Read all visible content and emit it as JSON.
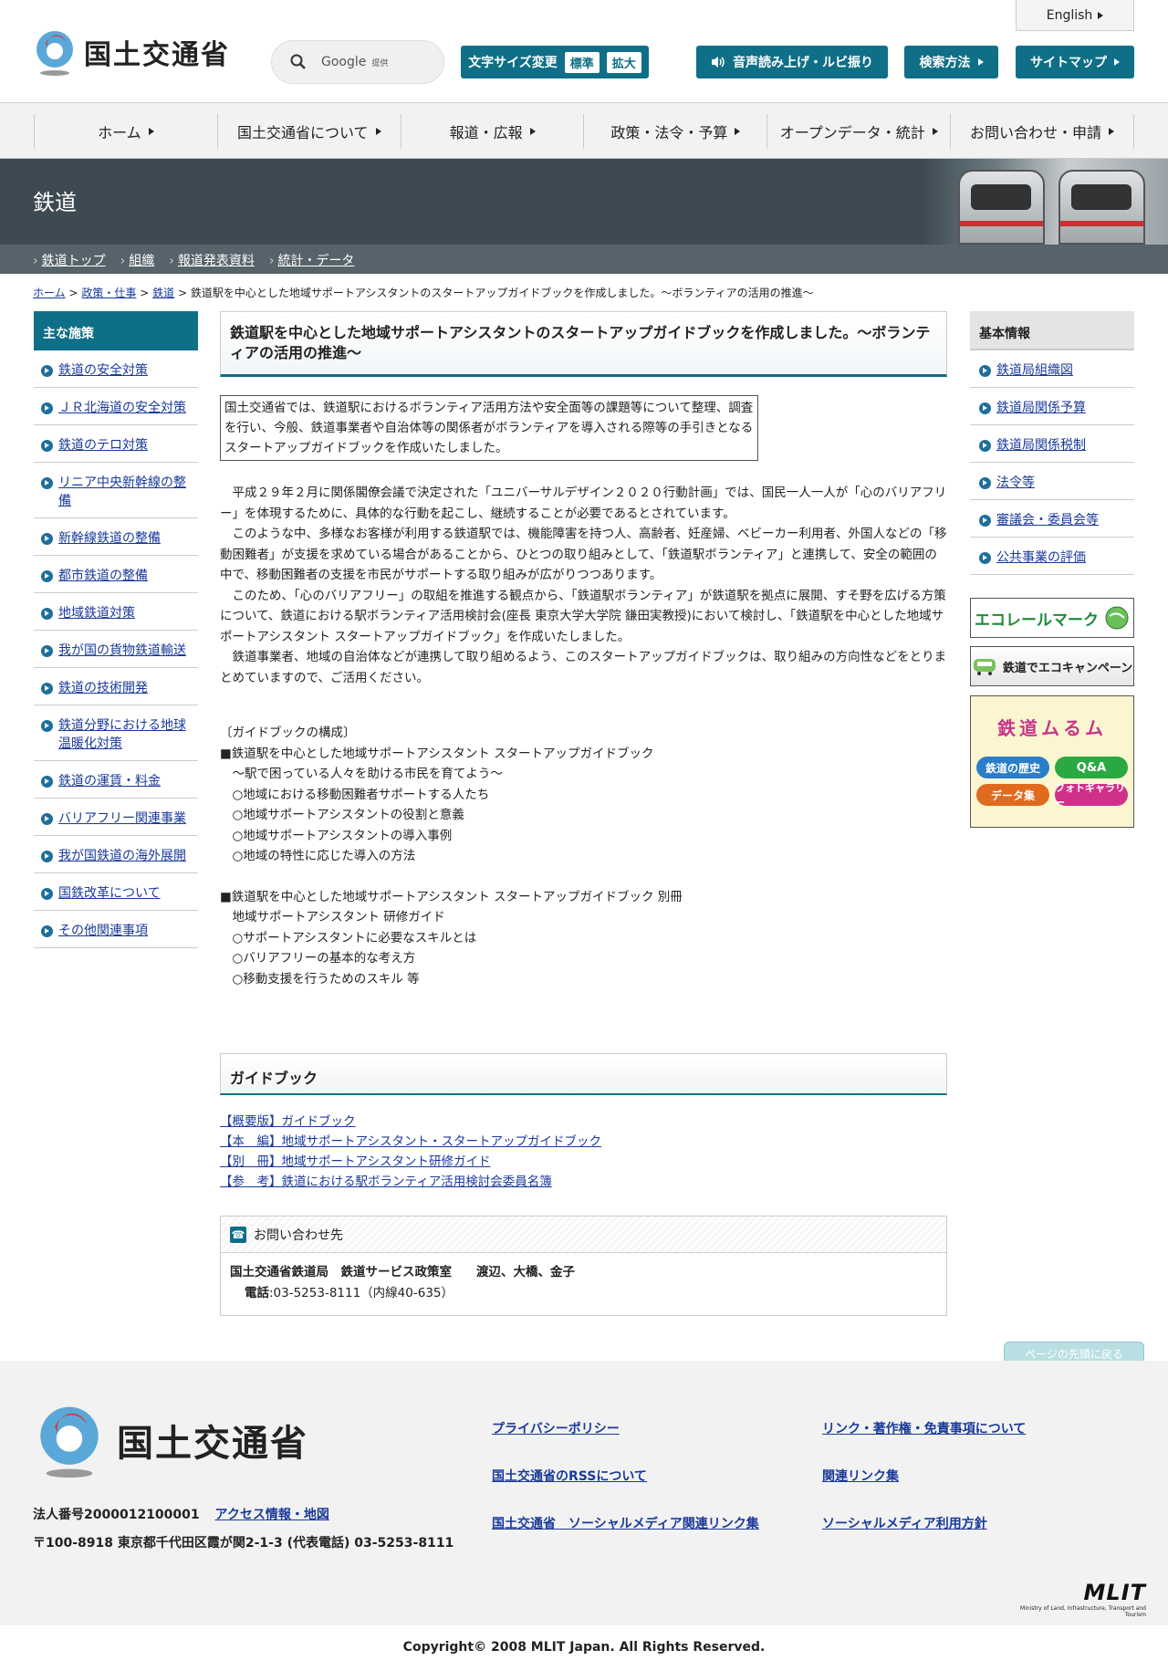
{
  "header": {
    "logo_text": "国土交通省",
    "search_label": "Google",
    "search_provider": "提供",
    "english": "English",
    "font_size_label": "文字サイズ変更",
    "font_standard": "標準",
    "font_large": "拡大",
    "voice": "音声読み上げ・ルビ振り",
    "search_method": "検索方法",
    "sitemap": "サイトマップ"
  },
  "gnav": [
    "ホーム",
    "国土交通省について",
    "報道・広報",
    "政策・法令・予算",
    "オープンデータ・統計",
    "お問い合わせ・申請"
  ],
  "hero": {
    "title": "鉄道"
  },
  "subnav": [
    "鉄道トップ",
    "組織",
    "報道発表資料",
    "統計・データ"
  ],
  "breadcrumb": {
    "home": "ホーム",
    "policy": "政策・仕事",
    "rail": "鉄道",
    "sep": ">",
    "current": "鉄道駅を中心とした地域サポートアシスタントのスタートアップガイドブックを作成しました。～ボランティアの活用の推進～"
  },
  "left_nav": {
    "heading": "主な施策",
    "items": [
      "鉄道の安全対策",
      "ＪＲ北海道の安全対策",
      "鉄道のテロ対策",
      "リニア中央新幹線の整備",
      "新幹線鉄道の整備",
      "都市鉄道の整備",
      "地域鉄道対策",
      "我が国の貨物鉄道輸送",
      "鉄道の技術開発",
      "鉄道分野における地球温暖化対策",
      "鉄道の運賃・料金",
      "バリアフリー関連事業",
      "我が国鉄道の海外展開",
      "国鉄改革について",
      "その他関連事項"
    ]
  },
  "main": {
    "title": "鉄道駅を中心とした地域サポートアシスタントのスタートアップガイドブックを作成しました。～ボランティアの活用の推進～",
    "lead": "国土交通省では、鉄道駅におけるボランティア活用方法や安全面等の課題等について整理、調査を行い、今般、鉄道事業者や自治体等の関係者がボランティアを導入される際等の手引きとなるスタートアップガイドブックを作成いたしました。",
    "paragraphs": [
      "平成２９年２月に関係閣僚会議で決定された「ユニバーサルデザイン２０２０行動計画」では、国民一人一人が「心のバリアフリー」を体現するために、具体的な行動を起こし、継続することが必要であるとされています。",
      "このような中、多様なお客様が利用する鉄道駅では、機能障害を持つ人、高齢者、妊産婦、ベビーカー利用者、外国人などの「移動困難者」が支援を求めている場合があることから、ひとつの取り組みとして、「鉄道駅ボランティア」と連携して、安全の範囲の中で、移動困難者の支援を市民がサポートする取り組みが広がりつつあります。",
      "このため、「心のバリアフリー」の取組を推進する観点から、「鉄道駅ボランティア」が鉄道駅を拠点に展開、すそ野を広げる方策について、鉄道における駅ボランティア活用検討会(座長 東京大学大学院 鎌田実教授)において検討し、「鉄道駅を中心とした地域サポートアシスタント スタートアップガイドブック」を作成いたしました。",
      "鉄道事業者、地域の自治体などが連携して取り組めるよう、このスタートアップガイドブックは、取り組みの方向性などをとりまとめていますので、ご活用ください。"
    ],
    "toc": [
      "〔ガイドブックの構成〕",
      "■鉄道駅を中心とした地域サポートアシスタント スタートアップガイドブック",
      "　～駅で困っている人々を助ける市民を育てよう～",
      "　○地域における移動困難者サポートする人たち",
      "　○地域サポートアシスタントの役割と意義",
      "　○地域サポートアシスタントの導入事例",
      "　○地域の特性に応じた導入の方法",
      "",
      "■鉄道駅を中心とした地域サポートアシスタント スタートアップガイドブック 別冊",
      "　地域サポートアシスタント 研修ガイド",
      "　○サポートアシスタントに必要なスキルとは",
      "　○バリアフリーの基本的な考え方",
      "　○移動支援を行うためのスキル 等"
    ],
    "guidebook_heading": "ガイドブック",
    "guidebook_links": [
      "【概要版】ガイドブック",
      "【本　編】地域サポートアシスタント・スタートアップガイドブック",
      "【別　冊】地域サポートアシスタント研修ガイド",
      "【参　考】鉄道における駅ボランティア活用検討会委員名簿"
    ],
    "contact": {
      "heading": "お問い合わせ先",
      "org": "国土交通省鉄道局　鉄道サービス政策室　　渡辺、大橋、金子",
      "tel_label": "電話",
      "tel": ":03-5253-8111（内線40-635）"
    }
  },
  "right_nav": {
    "heading": "基本情報",
    "items": [
      "鉄道局組織図",
      "鉄道局関係予算",
      "鉄道局関係税制",
      "法令等",
      "審議会・委員会等",
      "公共事業の評価"
    ],
    "banners": {
      "eco_rail": "エコレールマーク",
      "eco_campaign": "鉄道でエコキャンペーン",
      "museum_title": "鉄道ムるム",
      "museum_history": "鉄道の歴史",
      "museum_qa": "Q&A",
      "museum_data": "データ集",
      "museum_gallery": "フォトギャラリー"
    }
  },
  "page_top": "ページの先頭に戻る",
  "footer": {
    "logo_text": "国土交通省",
    "corp_no": "法人番号2000012100001",
    "access": "アクセス情報・地図",
    "address": "〒100-8918 東京都千代田区霞が関2-1-3 (代表電話) 03-5253-8111",
    "links_col1": [
      "プライバシーポリシー",
      "国土交通省のRSSについて",
      "国土交通省　ソーシャルメディア関連リンク集"
    ],
    "links_col2": [
      "リンク・著作権・免責事項について",
      "関連リンク集",
      "ソーシャルメディア利用方針"
    ],
    "mlit": "MLIT",
    "mlit_sub": "Ministry of Land, Infrastructure, Transport and Tourism",
    "copyright": "Copyright© 2008 MLIT Japan. All Rights Reserved."
  },
  "colors": {
    "accent": "#0f6f86",
    "hero": "#3d4a52",
    "link": "#1a3a9a"
  }
}
